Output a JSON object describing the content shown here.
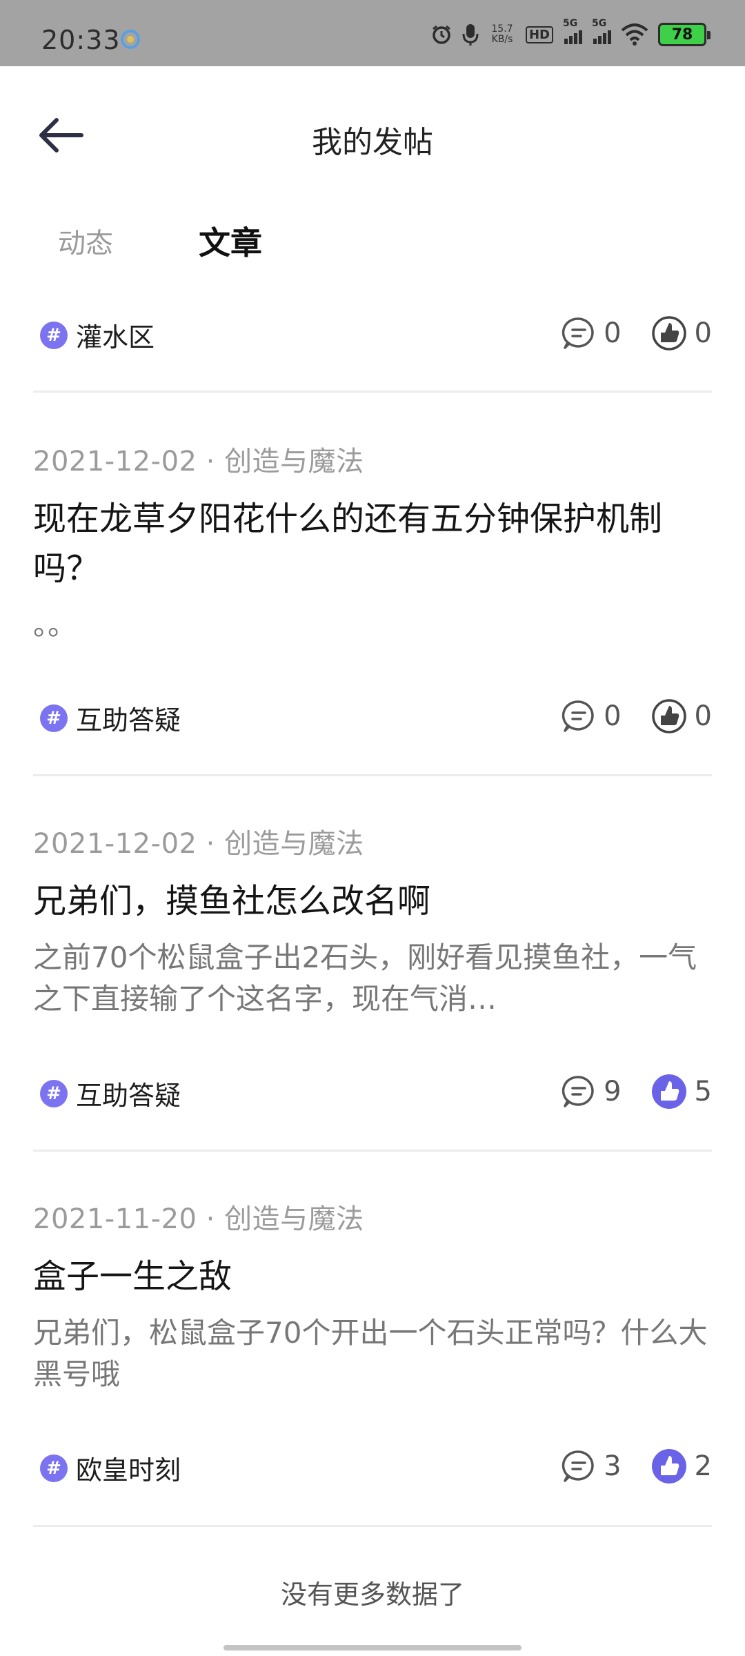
{
  "status_bar": {
    "time": "20:33",
    "net_speed_value": "15.7",
    "net_speed_unit": "KB/s",
    "hd_label": "HD",
    "sim1_label": "5G",
    "sim2_label": "5G",
    "battery": "78"
  },
  "header": {
    "title": "我的发帖"
  },
  "tabs": [
    {
      "label": "动态",
      "active": false
    },
    {
      "label": "文章",
      "active": true
    }
  ],
  "posts": [
    {
      "tag": "灌水区",
      "comments": "0",
      "likes": "0"
    },
    {
      "meta": "2021-12-02 · 创造与魔法",
      "title": "现在龙草夕阳花什么的还有五分钟保护机制吗？",
      "body": "。。",
      "tag": "互助答疑",
      "comments": "0",
      "likes": "0"
    },
    {
      "meta": "2021-12-02 · 创造与魔法",
      "title": "兄弟们，摸鱼社怎么改名啊",
      "body": "之前70个松鼠盒子出2石头，刚好看见摸鱼社，一气之下直接输了个这名字，现在气消…",
      "tag": "互助答疑",
      "comments": "9",
      "likes": "5"
    },
    {
      "meta": "2021-11-20 · 创造与魔法",
      "title": "盒子一生之敌",
      "body": "兄弟们，松鼠盒子70个开出一个石头正常吗？什么大黑号哦",
      "tag": "欧皇时刻",
      "comments": "3",
      "likes": "2"
    }
  ],
  "footer": {
    "no_more": "没有更多数据了"
  },
  "colors": {
    "tag_accent": "#7b73f0",
    "like_active": "#6a63e8",
    "status_bg": "#a3a3a3",
    "battery_fill": "#3ed048"
  }
}
